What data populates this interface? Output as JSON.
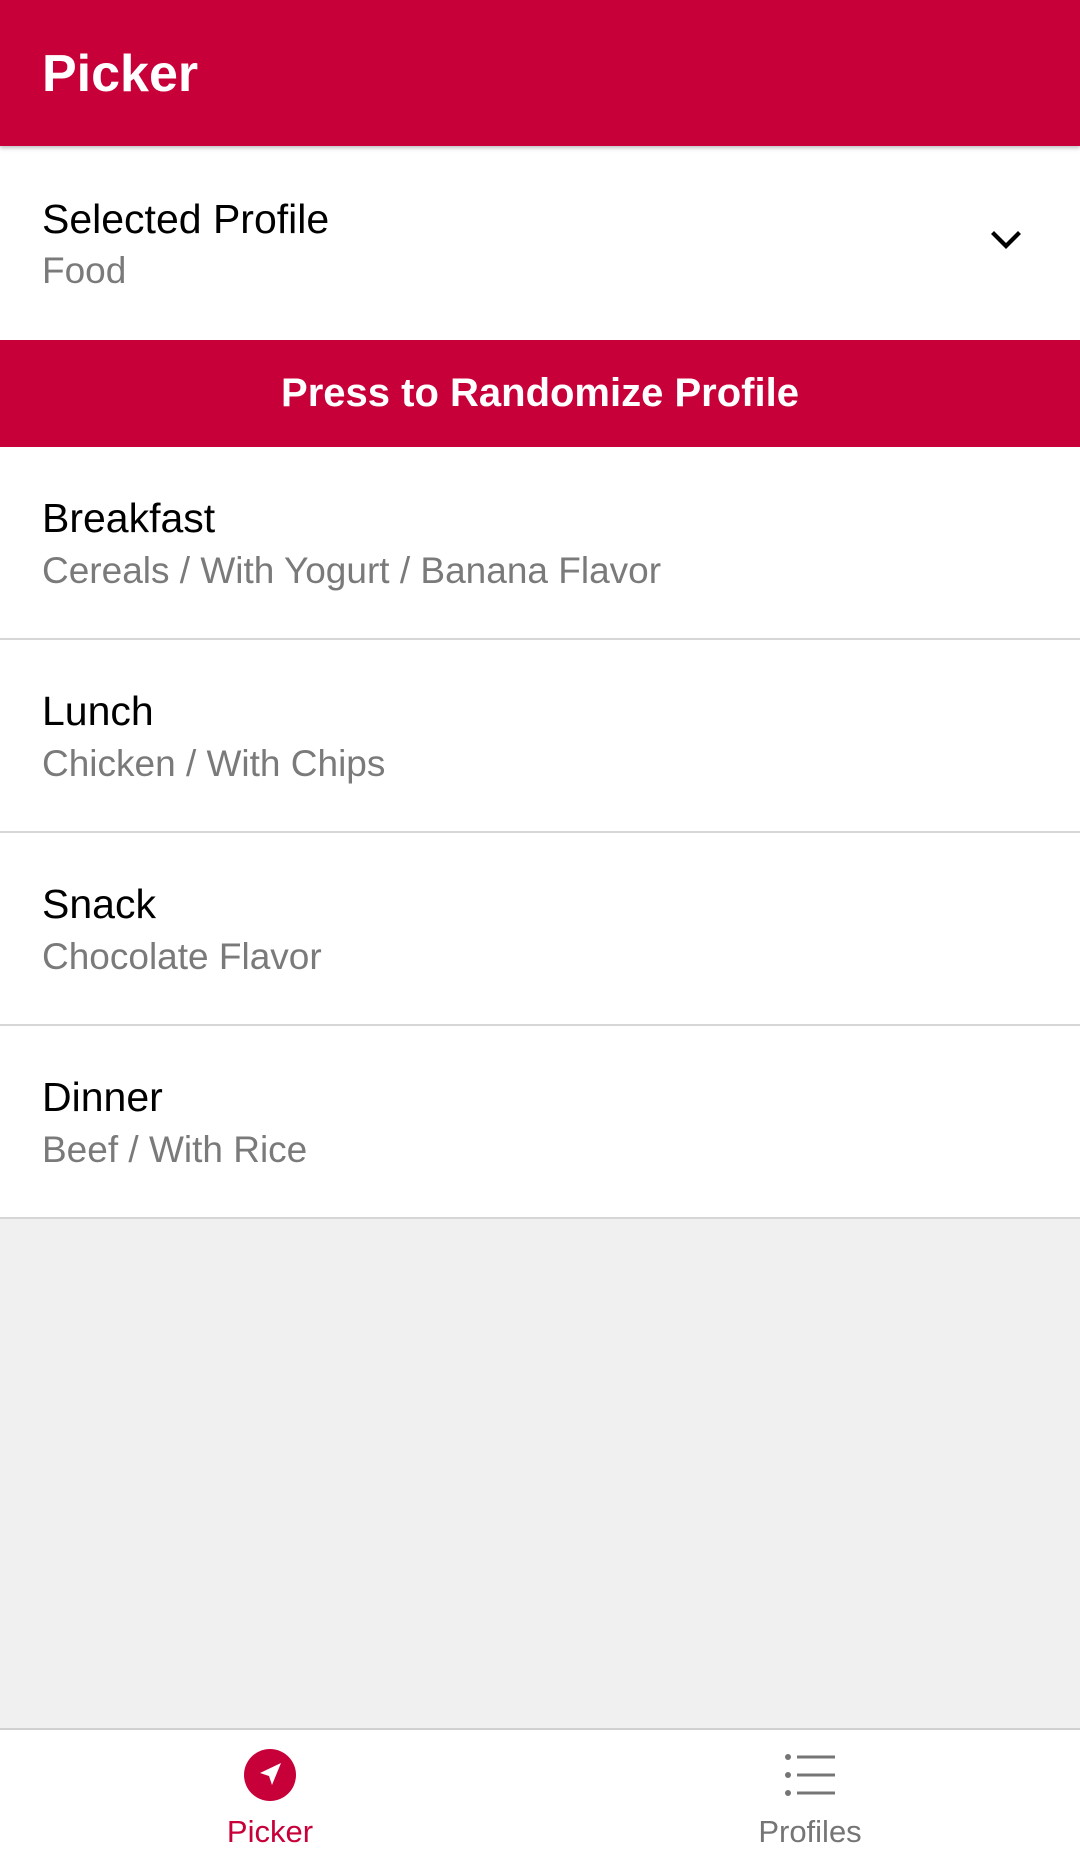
{
  "appbar": {
    "title": "Picker"
  },
  "profile": {
    "label": "Selected Profile",
    "value": "Food",
    "dropdown_icon": "chevron-down-icon"
  },
  "randomize_button": {
    "label": "Press to Randomize Profile"
  },
  "meals": [
    {
      "title": "Breakfast",
      "detail": "Cereals / With Yogurt / Banana Flavor"
    },
    {
      "title": "Lunch",
      "detail": "Chicken / With Chips"
    },
    {
      "title": "Snack",
      "detail": "Chocolate Flavor"
    },
    {
      "title": "Dinner",
      "detail": "Beef / With Rice"
    }
  ],
  "bottom_nav": {
    "items": [
      {
        "label": "Picker",
        "icon": "navigation-arrow-icon",
        "active": true
      },
      {
        "label": "Profiles",
        "icon": "list-icon",
        "active": false
      }
    ]
  },
  "colors": {
    "accent": "#c8003a",
    "background": "#f0f0f0",
    "secondary_text": "#7a7a7a"
  }
}
